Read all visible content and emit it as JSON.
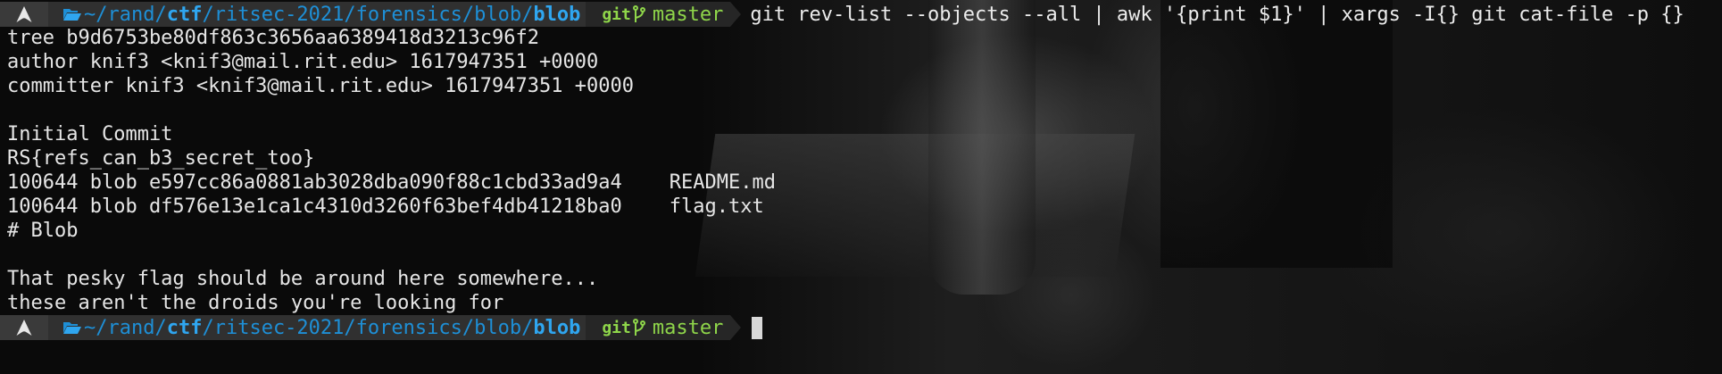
{
  "prompt": {
    "path_prefix": "~/rand/",
    "path_ctf": "ctf",
    "path_middle": "/ritsec-2021/forensics/blob/",
    "path_leaf": "blob",
    "git_label": "git",
    "branch": "master"
  },
  "command": "git rev-list --objects --all | awk '{print $1}' | xargs -I{} git cat-file -p {}",
  "output_lines": [
    "tree b9d6753be80df863c3656aa6389418d3213c96f2",
    "author knif3 <knif3@mail.rit.edu> 1617947351 +0000",
    "committer knif3 <knif3@mail.rit.edu> 1617947351 +0000",
    "",
    "Initial Commit",
    "RS{refs_can_b3_secret_too}",
    "100644 blob e597cc86a0881ab3028dba090f88c1cbd33ad9a4    README.md",
    "100644 blob df576e13e1ca1c4310d3260f63bef4db41218ba0    flag.txt",
    "# Blob",
    "",
    "That pesky flag should be around here somewhere...",
    "these aren't the droids you're looking for"
  ],
  "icons": {
    "os": "arch-linux-icon",
    "folder": "folder-open-icon",
    "branch": "git-branch-icon"
  },
  "colors": {
    "path_blue": "#1e8fd6",
    "git_green": "#8fd64a",
    "background": "#0a0a0a"
  }
}
